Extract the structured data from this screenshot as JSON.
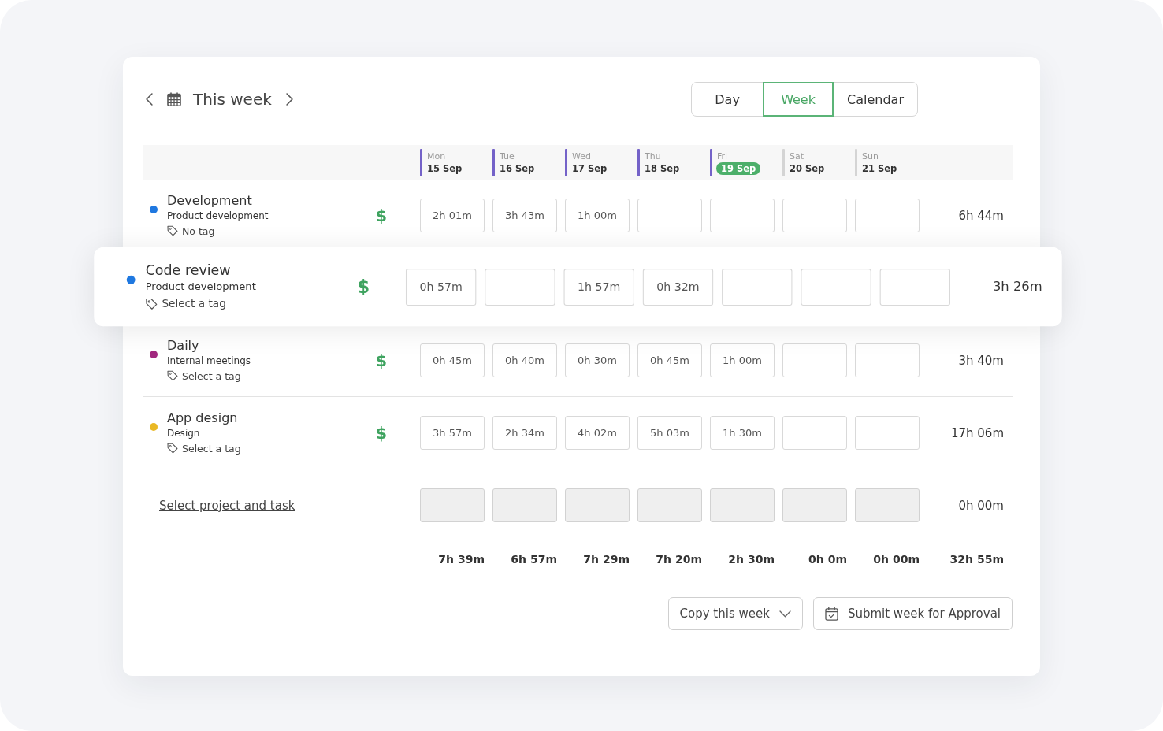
{
  "header": {
    "period": "This week",
    "views": [
      {
        "label": "Day",
        "selected": false
      },
      {
        "label": "Week",
        "selected": true
      },
      {
        "label": "Calendar",
        "selected": false
      }
    ]
  },
  "days": [
    {
      "name": "Mon",
      "date": "15 Sep",
      "color": "#7462c8",
      "today": false
    },
    {
      "name": "Tue",
      "date": "16 Sep",
      "color": "#7462c8",
      "today": false
    },
    {
      "name": "Wed",
      "date": "17 Sep",
      "color": "#7462c8",
      "today": false
    },
    {
      "name": "Thu",
      "date": "18 Sep",
      "color": "#7462c8",
      "today": false
    },
    {
      "name": "Fri",
      "date": "19 Sep",
      "color": "#7462c8",
      "today": true
    },
    {
      "name": "Sat",
      "date": "20 Sep",
      "color": "#d4d4d4",
      "today": false
    },
    {
      "name": "Sun",
      "date": "21 Sep",
      "color": "#d4d4d4",
      "today": false
    }
  ],
  "rows": [
    {
      "title": "Development",
      "project": "Product development",
      "tag": "No tag",
      "color": "#1f78e0",
      "billable": true,
      "billable_symbol": "$",
      "raised": false,
      "hours": [
        {
          "kind": "filled",
          "value": "2h 01m"
        },
        {
          "kind": "filled",
          "value": "3h 43m"
        },
        {
          "kind": "filled",
          "value": "1h 00m"
        },
        {
          "kind": "blank"
        },
        {
          "kind": "blank"
        },
        {
          "kind": "blank"
        },
        {
          "kind": "blank"
        }
      ],
      "total": "6h 44m"
    },
    {
      "title": "Code review",
      "project": "Product development",
      "tag": "Select a tag",
      "color": "#1f78e0",
      "billable": true,
      "billable_symbol": "$",
      "raised": true,
      "hours": [
        {
          "kind": "filled",
          "value": "0h 57m"
        },
        {
          "kind": "blank"
        },
        {
          "kind": "filled",
          "value": "1h 57m"
        },
        {
          "kind": "filled",
          "value": "0h 32m"
        },
        {
          "kind": "blank"
        },
        {
          "kind": "blank"
        },
        {
          "kind": "blank"
        }
      ],
      "total": "3h 26m"
    },
    {
      "title": "Daily",
      "project": "Internal meetings",
      "tag": "Select a tag",
      "color": "#a2287f",
      "billable": true,
      "billable_symbol": "$",
      "raised": false,
      "hours": [
        {
          "kind": "filled",
          "value": "0h 45m"
        },
        {
          "kind": "filled",
          "value": "0h 40m"
        },
        {
          "kind": "filled",
          "value": "0h 30m"
        },
        {
          "kind": "filled",
          "value": "0h 45m"
        },
        {
          "kind": "filled",
          "value": "1h 00m"
        },
        {
          "kind": "blank"
        },
        {
          "kind": "blank"
        }
      ],
      "total": "3h 40m"
    },
    {
      "title": "App design",
      "project": "Design",
      "tag": "Select a tag",
      "color": "#e9b824",
      "billable": true,
      "billable_symbol": "$",
      "raised": false,
      "hours": [
        {
          "kind": "filled",
          "value": "3h 57m"
        },
        {
          "kind": "filled",
          "value": "2h 34m"
        },
        {
          "kind": "filled",
          "value": "4h 02m"
        },
        {
          "kind": "filled",
          "value": "5h 03m"
        },
        {
          "kind": "filled",
          "value": "1h 30m"
        },
        {
          "kind": "blank"
        },
        {
          "kind": "blank"
        }
      ],
      "total": "17h 06m"
    }
  ],
  "new_entry": {
    "label": "Select project and task",
    "disabled": true,
    "total": "0h 00m"
  },
  "totals": {
    "days": [
      "7h 39m",
      "6h 57m",
      "7h 29m",
      "7h 20m",
      "2h 30m",
      "0h 0m",
      "0h 00m"
    ],
    "week": "32h 55m"
  },
  "actions": [
    {
      "label": "Copy this week",
      "kind": "dropdown"
    },
    {
      "label": "Submit week for Approval",
      "kind": "submit"
    }
  ]
}
